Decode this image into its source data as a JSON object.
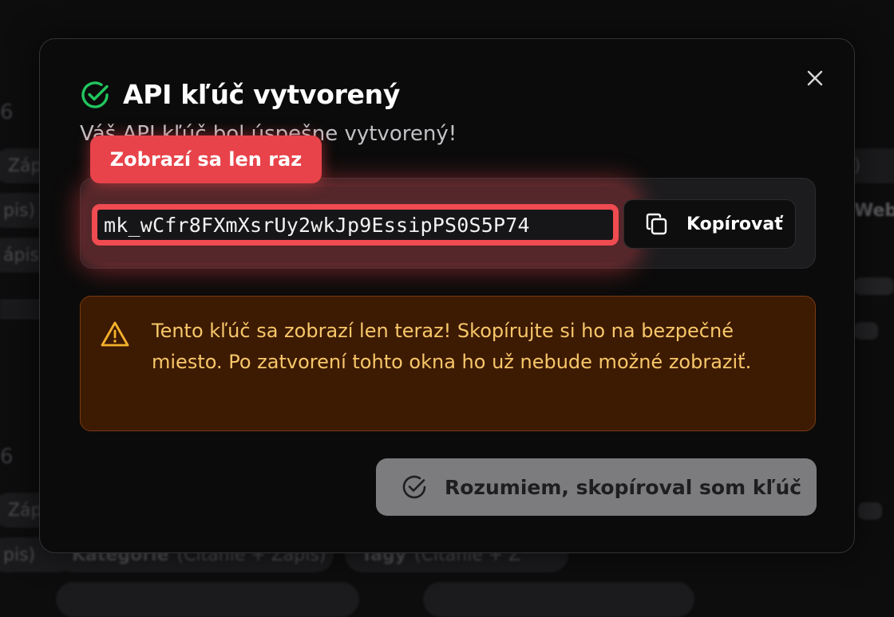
{
  "background": {
    "chips": [
      "Záp",
      "pis)",
      "ápis)",
      "Záp",
      "pis)",
      "ie)",
      "Web",
      "Kategórie",
      "(Čítanie + Zápis)",
      "Tagy",
      "(Čítanie + Z"
    ],
    "numbers": [
      "6",
      "6"
    ]
  },
  "modal": {
    "title": "API kľúč vytvorený",
    "subtitle": "Váš API kľúč bol úspešne vytvorený!",
    "badge": "Zobrazí sa len raz",
    "api_key": "mk_wCfr8FXmXsrUy2wkJp9EssipPS0S5P74",
    "copy_label": "Kopírovať",
    "warning": "Tento kľúč sa zobrazí len teraz! Skopírujte si ho na bezpečné miesto. Po zatvorení tohto okna ho už nebude možné zobraziť.",
    "ack_label": "Rozumiem, skopíroval som kľúč"
  },
  "icons": {
    "title": "check-circle-icon",
    "close": "close-icon",
    "copy": "copy-icon",
    "warning": "warning-triangle-icon",
    "ack": "check-circle-icon"
  },
  "colors": {
    "success": "#22c55e",
    "danger": "#e8434a",
    "warning_text": "#f7c76a",
    "warning_bg": "#3d1a02"
  }
}
